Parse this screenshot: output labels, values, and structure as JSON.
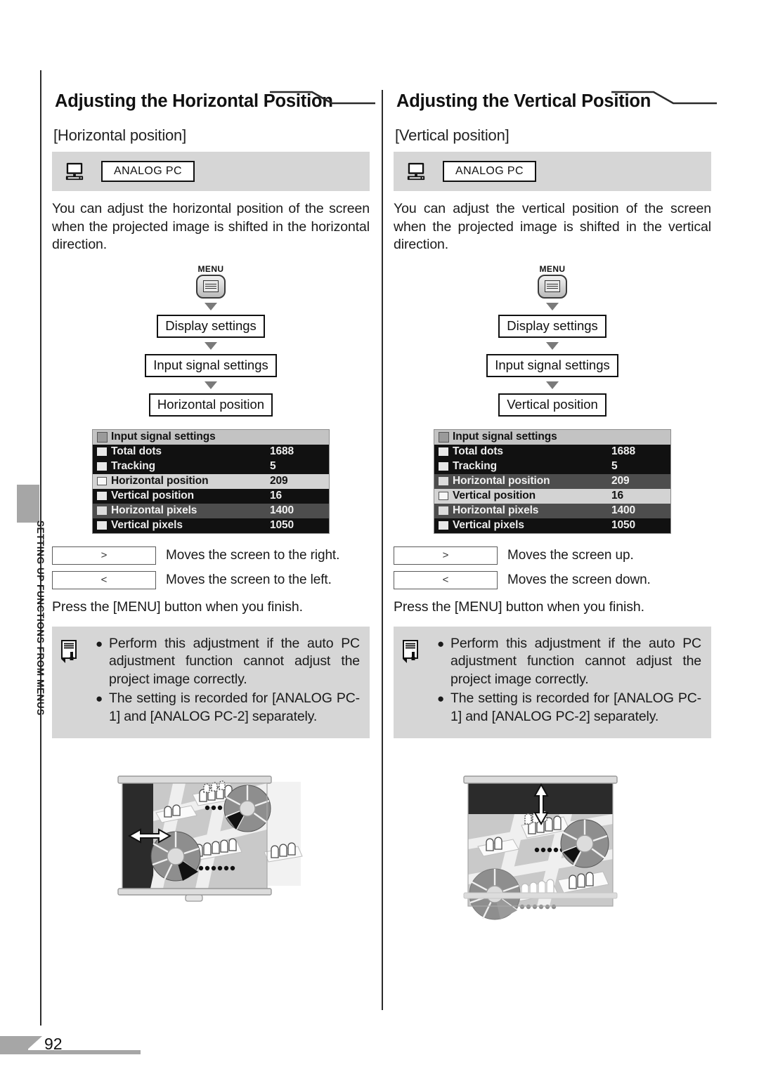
{
  "page": {
    "number": "92",
    "chapter_label": "SETTING UP FUNCTIONS FROM MENUS"
  },
  "columns": [
    {
      "title": "Adjusting the Horizontal Position",
      "subtitle": "[Horizontal position]",
      "signal": {
        "icon": "monitor-icon",
        "chip": "ANALOG PC"
      },
      "description": "You can adjust the horizontal position of the screen when the projected image is shifted in the horizontal direction.",
      "flow": {
        "menu_label": "MENU",
        "steps": [
          "Display settings",
          "Input signal settings",
          "Horizontal position"
        ]
      },
      "osd": {
        "header": "Input signal settings",
        "rows": [
          {
            "label": "Total dots",
            "value": "1688",
            "style": "dark"
          },
          {
            "label": "Tracking",
            "value": "5",
            "style": "dark"
          },
          {
            "label": "Horizontal position",
            "value": "209",
            "style": "sel"
          },
          {
            "label": "Vertical position",
            "value": "16",
            "style": "dark"
          },
          {
            "label": "Horizontal pixels",
            "value": "1400",
            "style": "mid"
          },
          {
            "label": "Vertical pixels",
            "value": "1050",
            "style": "dark"
          }
        ]
      },
      "keys": [
        {
          "button": ">",
          "desc": "Moves the screen to the right."
        },
        {
          "button": "<",
          "desc": "Moves the screen to the left."
        }
      ],
      "finish": "Press the [MENU] button when you finish.",
      "note": {
        "icon": "memo-icon",
        "items": [
          "Perform this adjustment if the auto PC adjustment function cannot adjust the project image correctly.",
          "The setting is recorded for [ANALOG PC-1] and [ANALOG PC-2] separately."
        ]
      },
      "illustration": "projection-screen-horizontal-shift"
    },
    {
      "title": "Adjusting the Vertical Position",
      "subtitle": "[Vertical position]",
      "signal": {
        "icon": "monitor-icon",
        "chip": "ANALOG PC"
      },
      "description": "You can adjust the vertical position of the screen when the projected image is shifted in the vertical direction.",
      "flow": {
        "menu_label": "MENU",
        "steps": [
          "Display settings",
          "Input signal settings",
          "Vertical position"
        ]
      },
      "osd": {
        "header": "Input signal settings",
        "rows": [
          {
            "label": "Total dots",
            "value": "1688",
            "style": "dark"
          },
          {
            "label": "Tracking",
            "value": "5",
            "style": "dark"
          },
          {
            "label": "Horizontal position",
            "value": "209",
            "style": "mid"
          },
          {
            "label": "Vertical position",
            "value": "16",
            "style": "sel"
          },
          {
            "label": "Horizontal pixels",
            "value": "1400",
            "style": "mid"
          },
          {
            "label": "Vertical pixels",
            "value": "1050",
            "style": "dark"
          }
        ]
      },
      "keys": [
        {
          "button": ">",
          "desc": "Moves the screen up."
        },
        {
          "button": "<",
          "desc": "Moves the screen down."
        }
      ],
      "finish": "Press the [MENU] button when you finish.",
      "note": {
        "icon": "memo-icon",
        "items": [
          "Perform this adjustment if the auto PC adjustment function cannot adjust the project image correctly.",
          "The setting is recorded for [ANALOG PC-1] and [ANALOG PC-2] separately."
        ]
      },
      "illustration": "projection-screen-vertical-shift"
    }
  ],
  "colors": {
    "band_gray": "#d6d6d6",
    "note_gray": "#d6d6d6",
    "tab_gray": "#a6a6a6",
    "osd_selected": "#d3d3d3",
    "osd_dark": "#111111",
    "osd_mid": "#4d4d4d"
  }
}
